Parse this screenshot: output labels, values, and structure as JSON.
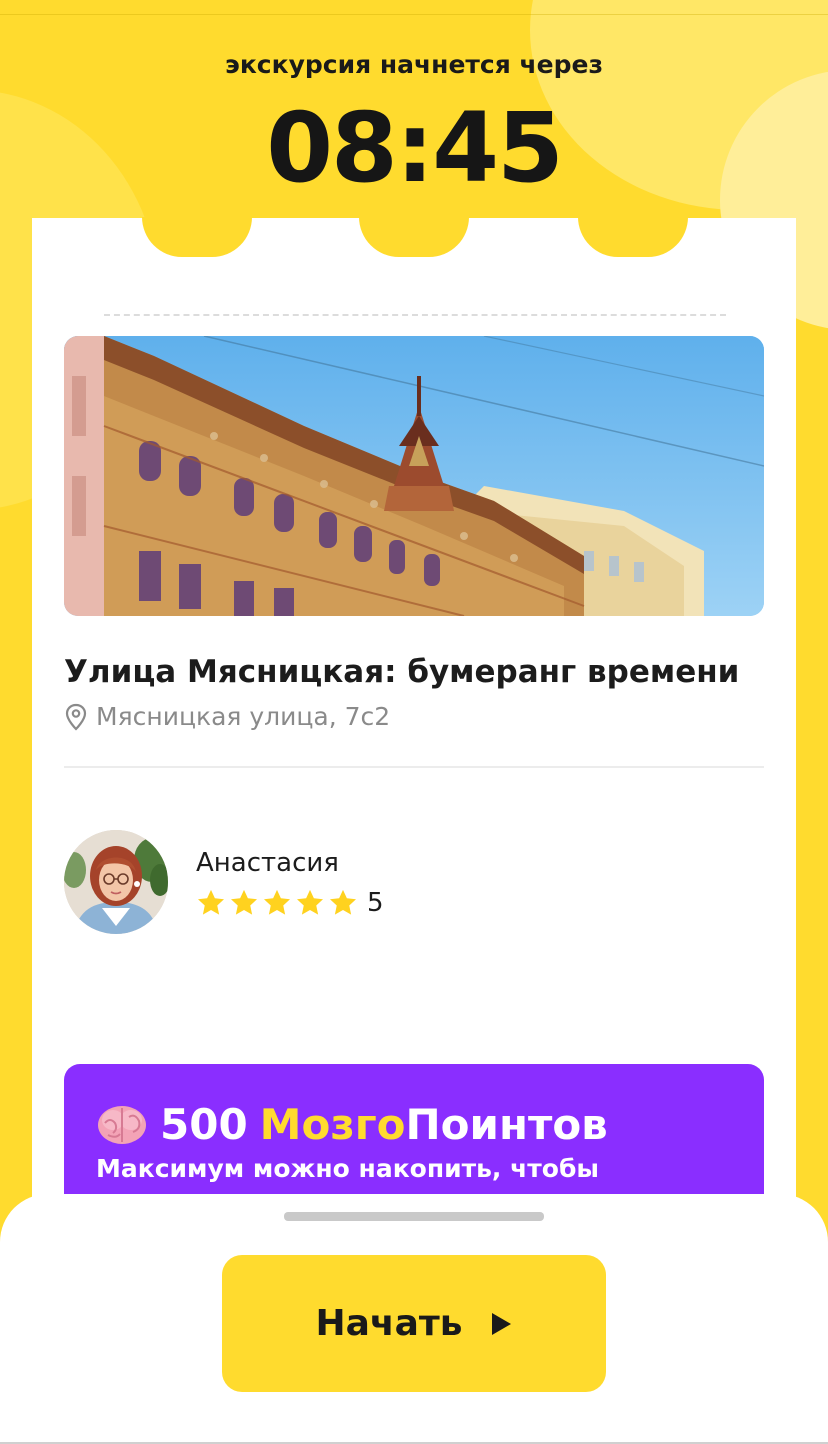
{
  "countdown": {
    "label": "экскурсия начнется через",
    "time": "08:45"
  },
  "tour": {
    "title": "Улица Мясницкая: бумеранг времени",
    "address": "Мясницкая улица, 7с2"
  },
  "guide": {
    "name": "Анастасия",
    "rating": 5,
    "rating_label": "5",
    "stars_total": 5
  },
  "promo": {
    "amount": "500",
    "brand": "Мозго",
    "points": "Поинтов",
    "subtitle": "Максимум можно накопить, чтобы"
  },
  "action": {
    "start_label": "Начать"
  },
  "icons": {
    "pin": "location-pin-icon",
    "star": "star-icon",
    "brain": "brain-emoji-icon",
    "play": "play-triangle-icon"
  },
  "colors": {
    "brand_yellow": "#FFDB2E",
    "promo_purple": "#8A2EFF",
    "text_dark": "#1C1C1C",
    "text_muted": "#8A8A8A",
    "star": "#FFD21F"
  }
}
